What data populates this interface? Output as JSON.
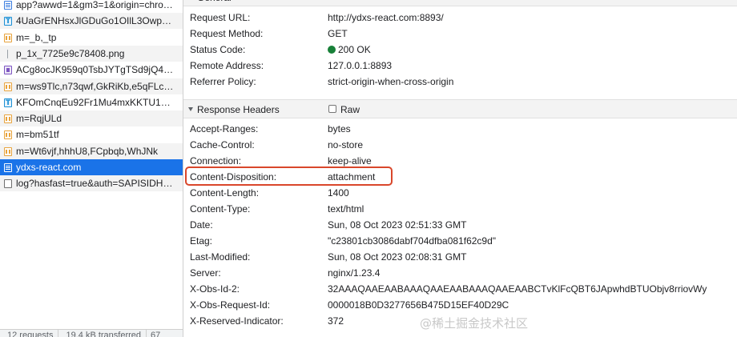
{
  "requests": [
    {
      "name": "app?awwd=1&gm3=1&origin=chro…",
      "icon": "document-icon"
    },
    {
      "name": "4UaGrENHsxJlGDuGo1OIlL3Owp…",
      "icon": "font-icon"
    },
    {
      "name": "m=_b,_tp",
      "icon": "script-icon"
    },
    {
      "name": "p_1x_7725e9c78408.png",
      "icon": "image-icon"
    },
    {
      "name": "ACg8ocJK959q0TsbJYTgTSd9jQ4…",
      "icon": "media-icon"
    },
    {
      "name": "m=ws9Tlc,n73qwf,GkRiKb,e5qFLc…",
      "icon": "script-icon"
    },
    {
      "name": "KFOmCnqEu92Fr1Mu4mxKKTU1…",
      "icon": "font-icon"
    },
    {
      "name": "m=RqjULd",
      "icon": "script-icon"
    },
    {
      "name": "m=bm51tf",
      "icon": "script-icon"
    },
    {
      "name": "m=Wt6vjf,hhhU8,FCpbqb,WhJNk",
      "icon": "script-icon"
    },
    {
      "name": "ydxs-react.com",
      "icon": "document-icon",
      "selected": true
    },
    {
      "name": "log?hasfast=true&auth=SAPISIDH…",
      "icon": "other-icon"
    }
  ],
  "status_bar": {
    "requests": "12 requests",
    "transferred": "19.4 kB transferred",
    "more": "67"
  },
  "general": {
    "title": "General",
    "rows": [
      {
        "key": "Request URL:",
        "value": "http://ydxs-react.com:8893/"
      },
      {
        "key": "Request Method:",
        "value": "GET"
      },
      {
        "key": "Status Code:",
        "value": "200 OK"
      },
      {
        "key": "Remote Address:",
        "value": "127.0.0.1:8893"
      },
      {
        "key": "Referrer Policy:",
        "value": "strict-origin-when-cross-origin"
      }
    ]
  },
  "response_headers": {
    "title": "Response Headers",
    "raw_label": "Raw",
    "rows": [
      {
        "key": "Accept-Ranges:",
        "value": "bytes"
      },
      {
        "key": "Cache-Control:",
        "value": "no-store"
      },
      {
        "key": "Connection:",
        "value": "keep-alive"
      },
      {
        "key": "Content-Disposition:",
        "value": "attachment",
        "highlighted": true
      },
      {
        "key": "Content-Length:",
        "value": "1400"
      },
      {
        "key": "Content-Type:",
        "value": "text/html"
      },
      {
        "key": "Date:",
        "value": "Sun, 08 Oct 2023 02:51:33 GMT"
      },
      {
        "key": "Etag:",
        "value": "\"c23801cb3086dabf704dfba081f62c9d\""
      },
      {
        "key": "Last-Modified:",
        "value": "Sun, 08 Oct 2023 02:08:31 GMT"
      },
      {
        "key": "Server:",
        "value": "nginx/1.23.4"
      },
      {
        "key": "X-Obs-Id-2:",
        "value": "32AAAQAAEAABAAAQAAEAABAAAQAAEAABCTvKlFcQBT6JApwhdBTUObjv8rriovWy"
      },
      {
        "key": "X-Obs-Request-Id:",
        "value": "0000018B0D3277656B475D15EF40D29C"
      },
      {
        "key": "X-Reserved-Indicator:",
        "value": "372"
      }
    ]
  },
  "colors": {
    "status_ok": "#188038",
    "selection": "#1a73e8",
    "highlight_border": "#d9472b"
  },
  "watermark": "@稀土掘金技术社区"
}
